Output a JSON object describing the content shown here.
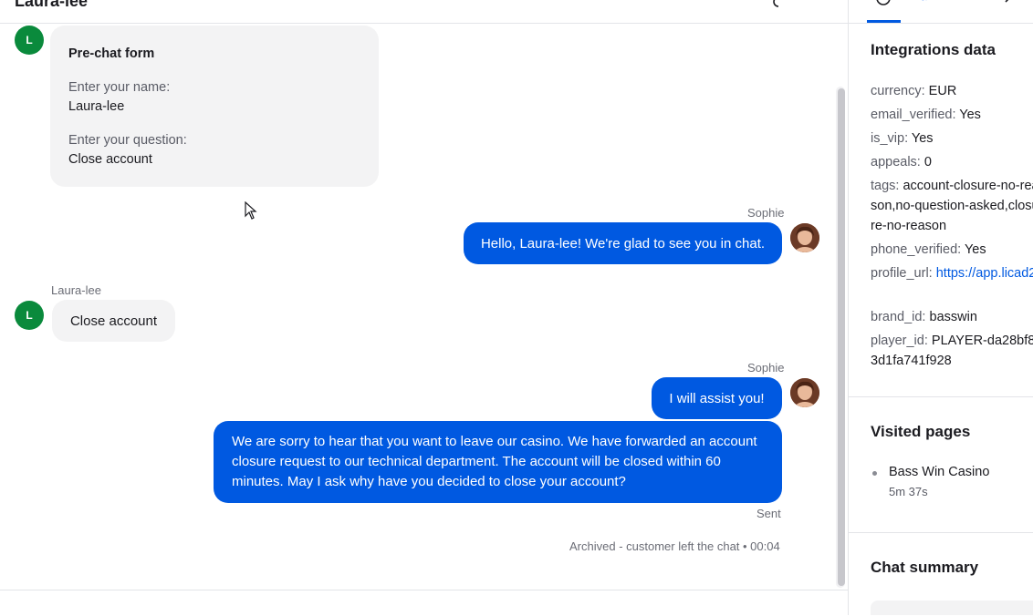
{
  "header": {
    "title": "Laura-lee"
  },
  "messages": {
    "prechat": {
      "avatar_initial": "L",
      "title": "Pre-chat form",
      "q1": "Enter your name:",
      "a1": "Laura-lee",
      "q2": "Enter your question:",
      "a2": "Close account"
    },
    "msg1": {
      "author": "Sophie",
      "text": "Hello, Laura-lee! We're glad to see you in chat."
    },
    "msg2": {
      "author": "Laura-lee",
      "avatar_initial": "L",
      "text": "Close account"
    },
    "msg3": {
      "author": "Sophie",
      "text": "I will assist you!"
    },
    "msg4": {
      "text": "We are sorry to hear that you want to leave our casino. We have forwarded an account closure request to our technical department. The account will be closed within 60 minutes. May I ask why have you decided to close your account?",
      "status": "Sent"
    },
    "archived": "Archived - customer left the chat • 00:04"
  },
  "panel": {
    "integrations_title": "Integrations data",
    "fields": [
      {
        "key": "currency:",
        "value": "EUR"
      },
      {
        "key": "email_verified:",
        "value": "Yes"
      },
      {
        "key": "is_vip:",
        "value": "Yes"
      },
      {
        "key": "appeals:",
        "value": "0"
      },
      {
        "key": "tags:",
        "value": "account-closure-no-reason,no-question-asked,closure-no-reason"
      },
      {
        "key": "phone_verified:",
        "value": "Yes"
      },
      {
        "key": "profile_url:",
        "value": "https://app.licad2"
      },
      {
        "key": "brand_id:",
        "value": "basswin"
      },
      {
        "key": "player_id:",
        "value": "PLAYER-da28bf83d1fa741f928"
      }
    ],
    "visited_title": "Visited pages",
    "visited": [
      {
        "name": "Bass Win Casino",
        "time": "5m 37s"
      }
    ],
    "summary_title": "Chat summary"
  }
}
